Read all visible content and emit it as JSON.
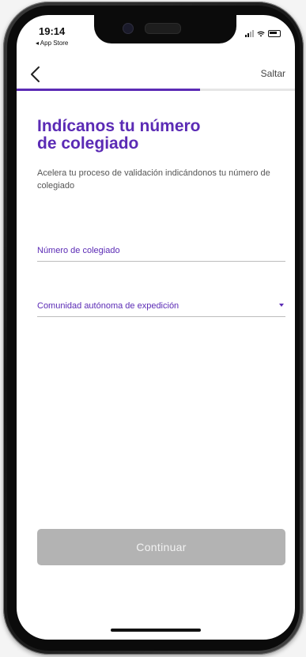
{
  "status_bar": {
    "time": "19:14",
    "back_app": "◂ App Store"
  },
  "nav": {
    "back_icon": "chevron-left-icon",
    "skip_label": "Saltar",
    "progress": 0.66
  },
  "content": {
    "title": "Indícanos tu número\nde colegiado",
    "subtitle": "Acelera tu proceso de validación indicándonos tu número de colegiado"
  },
  "form": {
    "number_label": "Número de colegiado",
    "region_label": "Comunidad autónoma de expedición"
  },
  "actions": {
    "continue_label": "Continuar"
  },
  "colors": {
    "accent": "#5b2bb5",
    "button_disabled": "#b3b3b3"
  }
}
